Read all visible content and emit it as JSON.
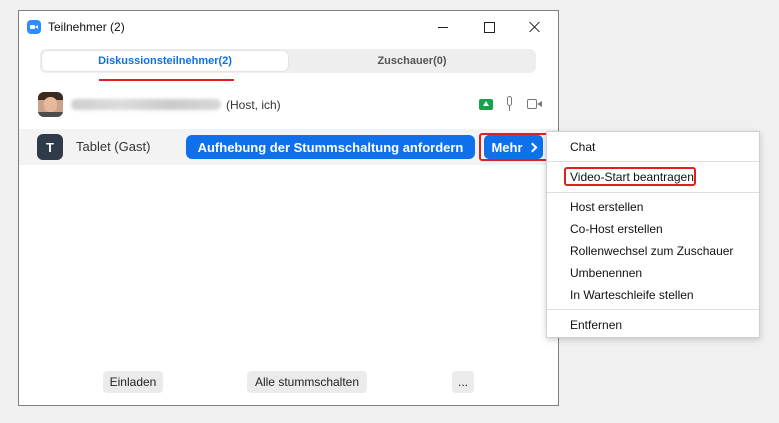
{
  "window": {
    "title": "Teilnehmer (2)"
  },
  "tabs": [
    {
      "label": "Diskussionsteilnehmer(2)",
      "active": true
    },
    {
      "label": "Zuschauer(0)",
      "active": false
    }
  ],
  "participants": [
    {
      "name_suffix": "(Host, ich)",
      "name_blurred": true,
      "icons": [
        "share-screen-icon",
        "microphone-icon",
        "video-camera-icon"
      ]
    },
    {
      "avatar_letter": "T",
      "name": "Tablet (Gast)",
      "unmute_label": "Aufhebung der Stummschaltung anfordern",
      "more_label": "Mehr"
    }
  ],
  "footer": {
    "invite_label": "Einladen",
    "mute_all_label": "Alle stummschalten",
    "more_label": "..."
  },
  "menu": {
    "items": [
      "Chat",
      "Video-Start beantragen",
      "Host erstellen",
      "Co-Host erstellen",
      "Rollenwechsel zum Zuschauer",
      "Umbenennen",
      "In Warteschleife stellen",
      "Entfernen"
    ]
  },
  "colors": {
    "accent": "#0e71eb",
    "highlight": "#e02020",
    "share_green": "#16a34a"
  }
}
